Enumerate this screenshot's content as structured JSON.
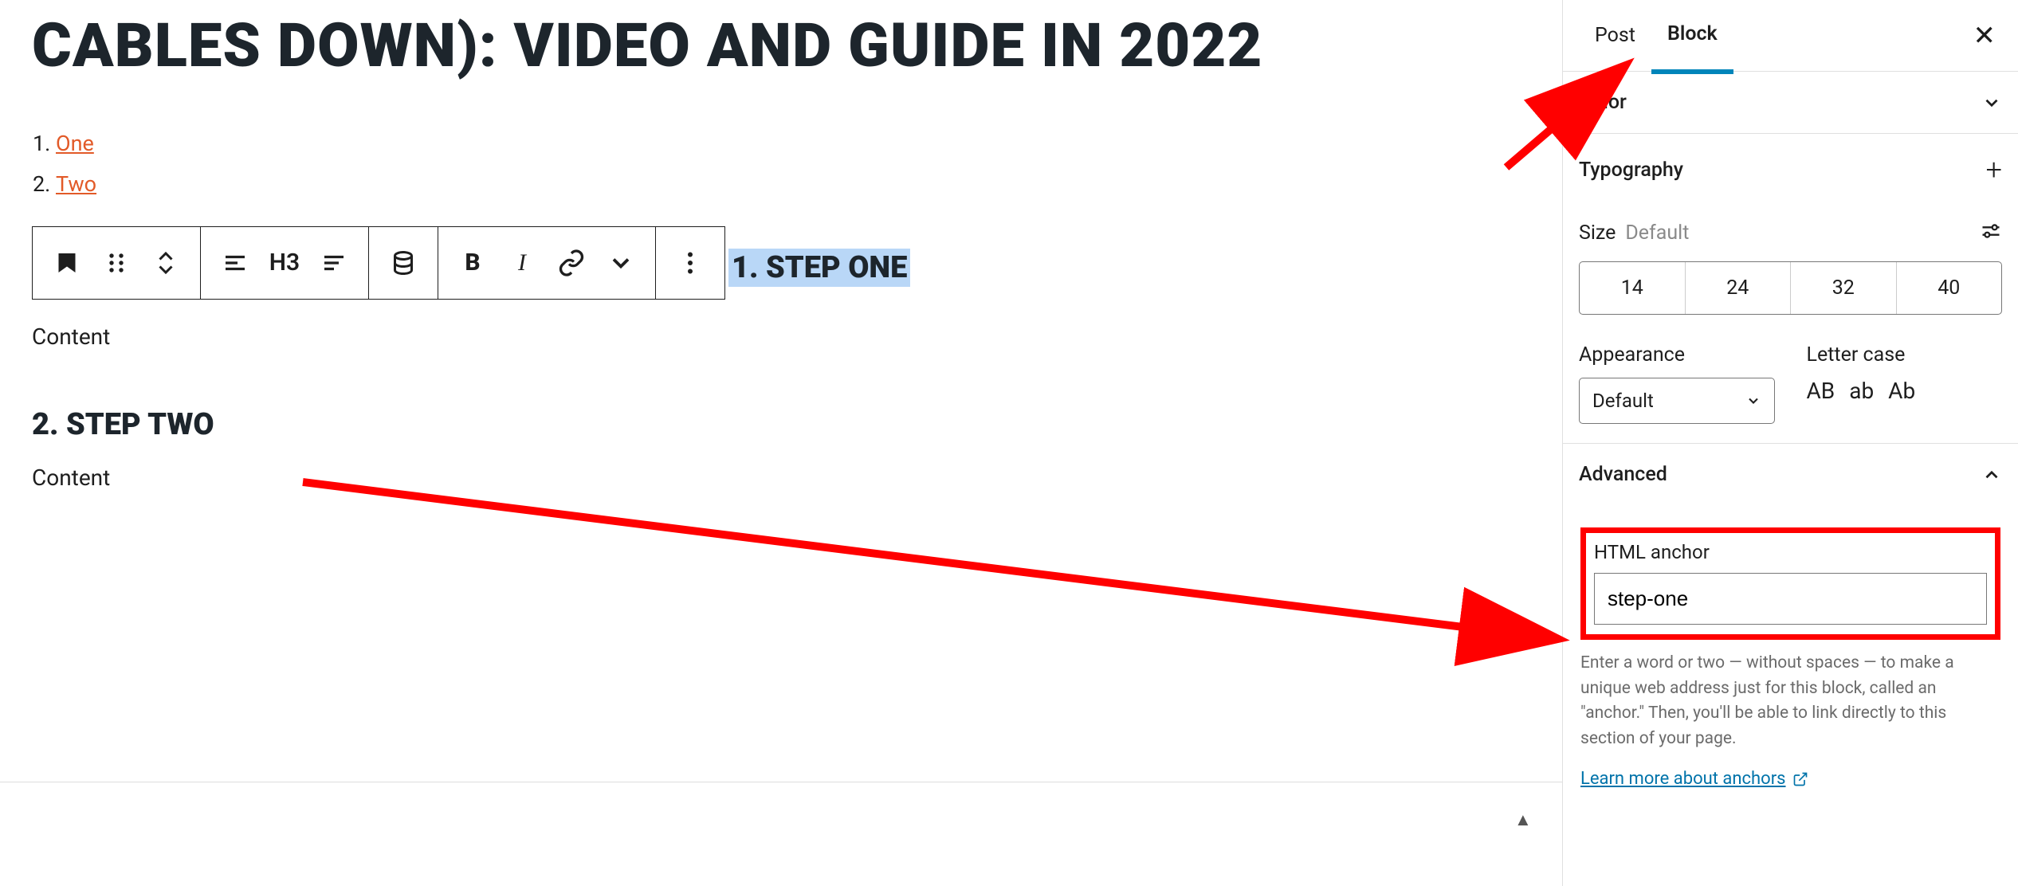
{
  "title": "CABLES DOWN): VIDEO AND GUIDE IN 2022",
  "toc": [
    {
      "label": "One",
      "href": "#one"
    },
    {
      "label": "Two",
      "href": "#two"
    }
  ],
  "toolbar": {
    "heading_level": "H3"
  },
  "blocks": {
    "h1": "1. STEP ONE",
    "c1": "Content",
    "h2": "2. STEP TWO",
    "c2": "Content"
  },
  "sidebar": {
    "tabs": {
      "post": "Post",
      "block": "Block"
    },
    "color_label": "Color",
    "typography_label": "Typography",
    "size_label": "Size",
    "size_default": "Default",
    "sizes": [
      "14",
      "24",
      "32",
      "40"
    ],
    "appearance_label": "Appearance",
    "appearance_value": "Default",
    "lettercase_label": "Letter case",
    "lettercases": [
      "AB",
      "ab",
      "Ab"
    ],
    "advanced_label": "Advanced",
    "anchor_label": "HTML anchor",
    "anchor_value": "step-one",
    "anchor_help": "Enter a word or two — without spaces — to make a unique web address just for this block, called an \"anchor.\" Then, you'll be able to link directly to this section of your page.",
    "learn_more": "Learn more about anchors"
  }
}
